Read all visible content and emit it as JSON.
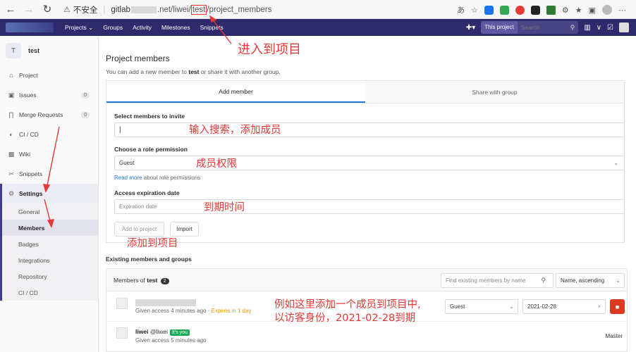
{
  "browser": {
    "insecure_label": "不安全",
    "url_host_prefix": "gitlab",
    "url_host_suffix": ".net/liwei/",
    "url_project": "test",
    "url_tail": "/project_members"
  },
  "topnav": {
    "links": [
      "Projects ⌄",
      "Groups",
      "Activity",
      "Milestones",
      "Snippets"
    ],
    "search_scope": "This project",
    "search_placeholder": "Search"
  },
  "sidebar": {
    "project_initial": "T",
    "project_name": "test",
    "items": [
      {
        "label": "Project",
        "icon": "home-icon"
      },
      {
        "label": "Issues",
        "icon": "issues-icon",
        "count": "0"
      },
      {
        "label": "Merge Requests",
        "icon": "merge-request-icon",
        "count": "0"
      },
      {
        "label": "CI / CD",
        "icon": "rocket-icon"
      },
      {
        "label": "Wiki",
        "icon": "book-icon"
      },
      {
        "label": "Snippets",
        "icon": "scissors-icon"
      },
      {
        "label": "Settings",
        "icon": "gear-icon"
      }
    ],
    "settings_sub": [
      "General",
      "Members",
      "Badges",
      "Integrations",
      "Repository",
      "CI / CD"
    ]
  },
  "main": {
    "title": "Project members",
    "subtitle_pre": "You can add a new member to ",
    "subtitle_project": "test",
    "subtitle_post": " or share it with another group.",
    "tabs": [
      "Add member",
      "Share with group"
    ],
    "select_label": "Select members to invite",
    "role_label": "Choose a role permission",
    "role_value": "Guest",
    "read_more_link": "Read more",
    "read_more_rest": " about role permissions",
    "expiration_label": "Access expiration date",
    "expiration_placeholder": "Expiration date",
    "add_button": "Add to project",
    "import_button": "Import"
  },
  "existing": {
    "section_title": "Existing members and groups",
    "header_pre": "Members of ",
    "header_project": "test",
    "count": "2",
    "filter_placeholder": "Find existing members by name",
    "sort_value": "Name, ascending",
    "members": [
      {
        "meta": "Given access 4 minutes ago",
        "expires": "Expires in 1 day",
        "role": "Guest",
        "date": "2021-02-28"
      },
      {
        "name": "liwei",
        "handle": "@liwei",
        "you_badge": "It's you",
        "meta": "Given access 5 minutes ago",
        "role": "Master"
      }
    ]
  },
  "annotations": {
    "enter_project": "进入到项目",
    "search_add": "输入搜索，添加成员",
    "member_permission": "成员权限",
    "expiry_time": "到期时间",
    "add_to_project": "添加到项目",
    "example_line1": "例如这里添加一个成员到项目中,",
    "example_line2": "以访客身份，2021-02-28到期",
    "color": "#e53935"
  }
}
